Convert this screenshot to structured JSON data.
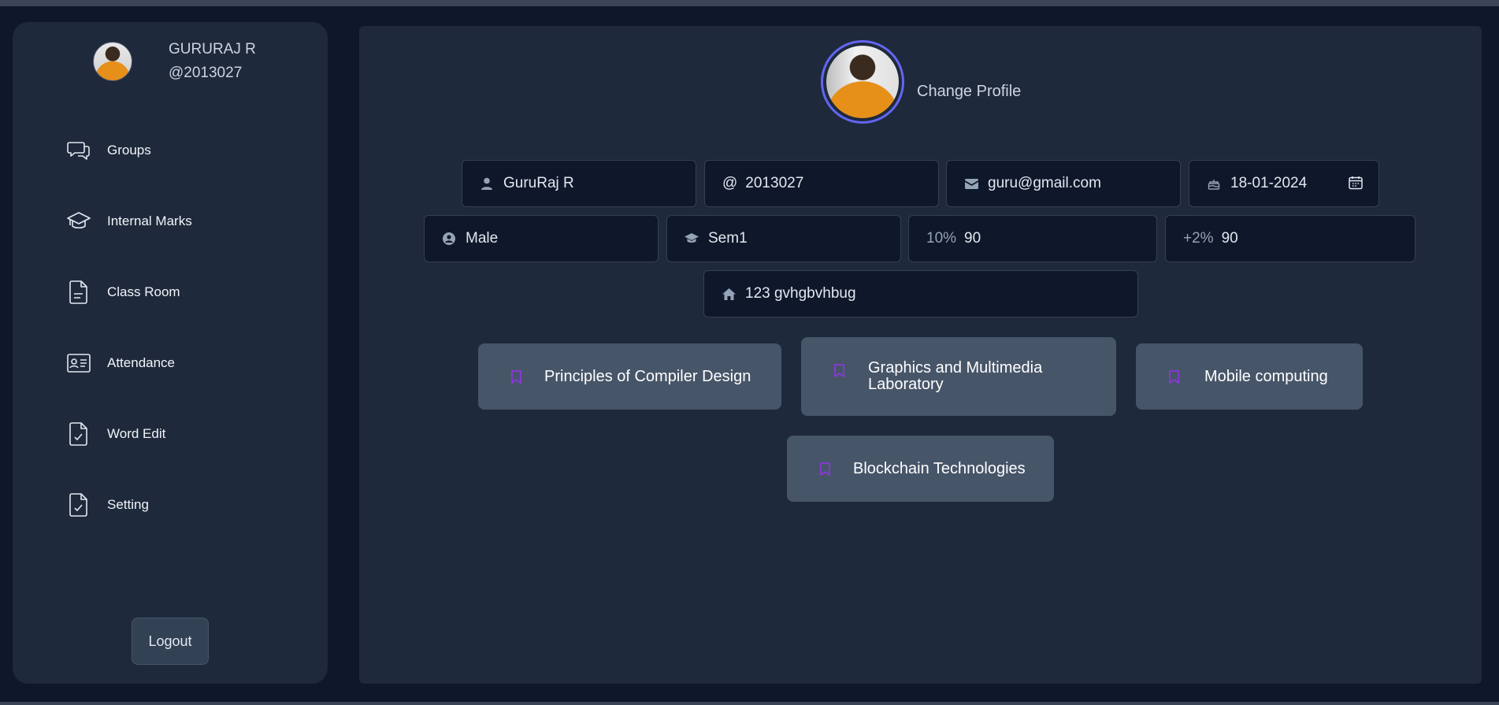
{
  "user": {
    "name": "GURURAJ R",
    "handle": "@2013027"
  },
  "sidebar": {
    "items": [
      {
        "label": "Groups",
        "icon": "chat-bubbles-icon"
      },
      {
        "label": "Internal Marks",
        "icon": "graduation-cap-icon"
      },
      {
        "label": "Class Room",
        "icon": "document-icon"
      },
      {
        "label": "Attendance",
        "icon": "id-card-icon"
      },
      {
        "label": "Word Edit",
        "icon": "file-check-icon"
      },
      {
        "label": "Setting",
        "icon": "file-check-icon"
      }
    ],
    "logout_label": "Logout"
  },
  "profile": {
    "change_profile_label": "Change Profile",
    "fields": {
      "name": "GuruRaj R",
      "username_prefix": "@",
      "username": "2013027",
      "email": "guru@gmail.com",
      "dob": "18-01-2024",
      "gender": "Male",
      "semester": "Sem1",
      "tenth_prefix": "10%",
      "tenth_score": "90",
      "twelfth_prefix": "+2%",
      "twelfth_score": "90",
      "address": "123 gvhgbvhbug"
    }
  },
  "courses": [
    "Principles of Compiler Design",
    "Graphics and Multimedia Laboratory",
    "Mobile computing",
    "Blockchain Technologies"
  ],
  "colors": {
    "background": "#0f172a",
    "panel": "#1e293b",
    "course_card": "#475569",
    "bookmark": "#9333ea",
    "avatar_ring": "#6366f1"
  }
}
